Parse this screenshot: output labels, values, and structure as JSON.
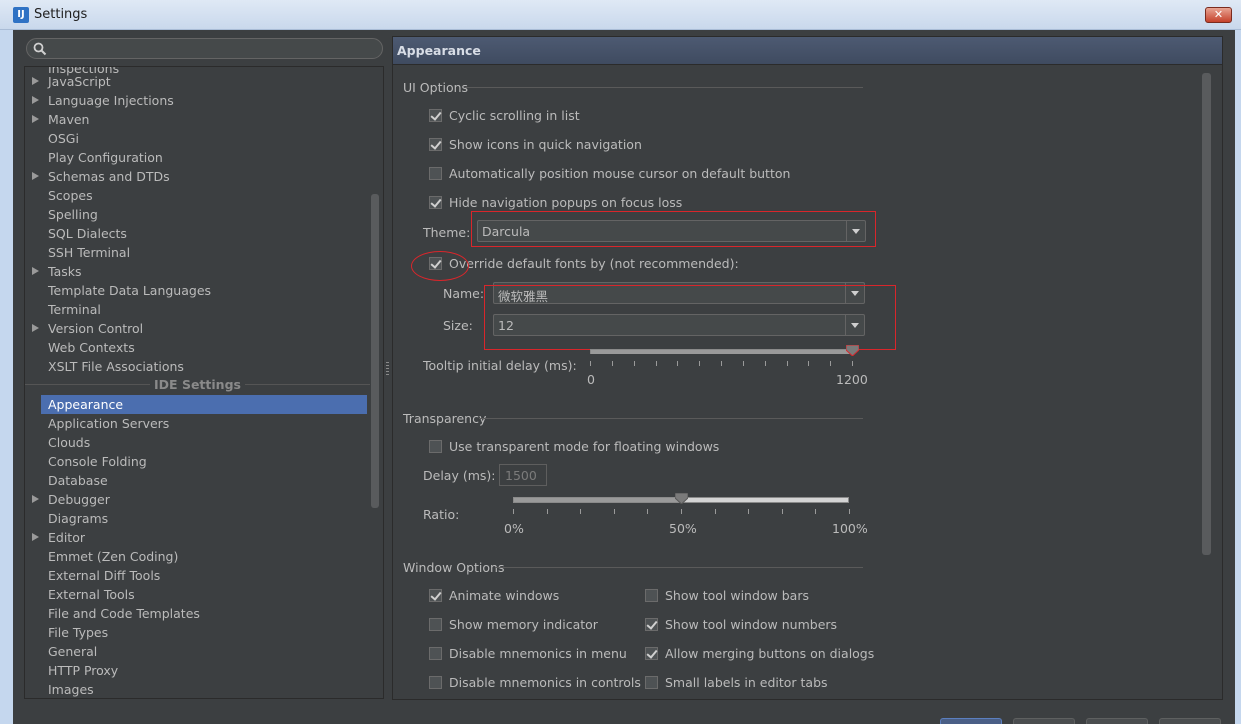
{
  "window": {
    "title": "Settings",
    "app_icon": "intellij-icon",
    "close_icon": "close-icon"
  },
  "search": {
    "placeholder": "",
    "icon": "search-icon"
  },
  "tree": {
    "partial_top": "Inspections",
    "project_items": [
      {
        "label": "JavaScript",
        "expandable": true
      },
      {
        "label": "Language Injections",
        "expandable": true
      },
      {
        "label": "Maven",
        "expandable": true
      },
      {
        "label": "OSGi",
        "expandable": false
      },
      {
        "label": "Play Configuration",
        "expandable": false
      },
      {
        "label": "Schemas and DTDs",
        "expandable": true
      },
      {
        "label": "Scopes",
        "expandable": false
      },
      {
        "label": "Spelling",
        "expandable": false
      },
      {
        "label": "SQL Dialects",
        "expandable": false
      },
      {
        "label": "SSH Terminal",
        "expandable": false
      },
      {
        "label": "Tasks",
        "expandable": true
      },
      {
        "label": "Template Data Languages",
        "expandable": false
      },
      {
        "label": "Terminal",
        "expandable": false
      },
      {
        "label": "Version Control",
        "expandable": true
      },
      {
        "label": "Web Contexts",
        "expandable": false
      },
      {
        "label": "XSLT File Associations",
        "expandable": false
      }
    ],
    "ide_group": "IDE Settings",
    "ide_items": [
      {
        "label": "Appearance",
        "expandable": false,
        "selected": true
      },
      {
        "label": "Application Servers",
        "expandable": false
      },
      {
        "label": "Clouds",
        "expandable": false
      },
      {
        "label": "Console Folding",
        "expandable": false
      },
      {
        "label": "Database",
        "expandable": false
      },
      {
        "label": "Debugger",
        "expandable": true
      },
      {
        "label": "Diagrams",
        "expandable": false
      },
      {
        "label": "Editor",
        "expandable": true
      },
      {
        "label": "Emmet (Zen Coding)",
        "expandable": false
      },
      {
        "label": "External Diff Tools",
        "expandable": false
      },
      {
        "label": "External Tools",
        "expandable": false
      },
      {
        "label": "File and Code Templates",
        "expandable": false
      },
      {
        "label": "File Types",
        "expandable": false
      },
      {
        "label": "General",
        "expandable": false
      },
      {
        "label": "HTTP Proxy",
        "expandable": false
      },
      {
        "label": "Images",
        "expandable": false
      }
    ]
  },
  "panel": {
    "title": "Appearance",
    "ui_options": {
      "heading": "UI Options",
      "cyclic_scrolling": {
        "label": "Cyclic scrolling in list",
        "checked": true
      },
      "show_icons": {
        "label": "Show icons in quick navigation",
        "checked": true
      },
      "auto_position": {
        "label": "Automatically position mouse cursor on default button",
        "checked": false
      },
      "hide_nav": {
        "label": "Hide navigation popups on focus loss",
        "checked": true
      },
      "theme_label": "Theme:",
      "theme_value": "Darcula",
      "override_fonts": {
        "label": "Override default fonts by (not recommended):",
        "checked": true
      },
      "name_label": "Name:",
      "name_value": "微软雅黑",
      "size_label": "Size:",
      "size_value": "12",
      "tooltip_label": "Tooltip initial delay (ms):",
      "tooltip_min": "0",
      "tooltip_max": "1200",
      "tooltip_value_fraction": 1.0
    },
    "transparency": {
      "heading": "Transparency",
      "use_transparent": {
        "label": "Use transparent mode for floating windows",
        "checked": false
      },
      "delay_label": "Delay (ms):",
      "delay_value": "1500",
      "ratio_label": "Ratio:",
      "ratio_ticks": [
        "0%",
        "50%",
        "100%"
      ],
      "ratio_value_fraction": 0.5
    },
    "window_options": {
      "heading": "Window Options",
      "animate_windows": {
        "label": "Animate windows",
        "checked": true
      },
      "show_tool_window_bars": {
        "label": "Show tool window bars",
        "checked": false
      },
      "show_memory": {
        "label": "Show memory indicator",
        "checked": false
      },
      "show_tool_window_numbers": {
        "label": "Show tool window numbers",
        "checked": true
      },
      "disable_mnemonics_menu": {
        "label": "Disable mnemonics in menu",
        "checked": false
      },
      "allow_merging": {
        "label": "Allow merging buttons on dialogs",
        "checked": true
      },
      "disable_mnemonics_controls": {
        "label": "Disable mnemonics in controls",
        "checked": false
      },
      "small_labels": {
        "label": "Small labels in editor tabs",
        "checked": false
      }
    }
  },
  "colors": {
    "background": "#3c3f41",
    "selection": "#4b6eaf",
    "annotation": "#d9262b"
  }
}
